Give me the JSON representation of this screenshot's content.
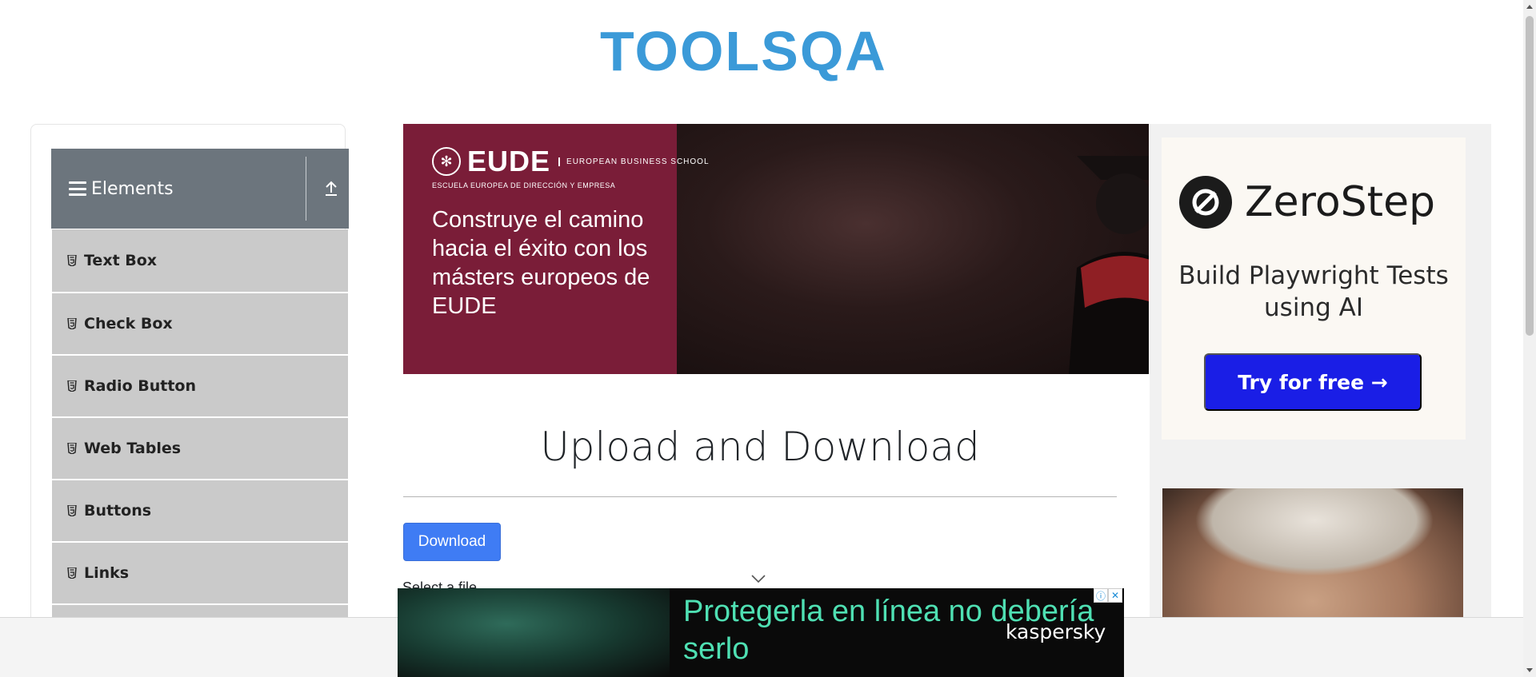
{
  "header": {
    "logo_text": "TOOLSQA"
  },
  "sidebar": {
    "group_title": "Elements",
    "items": [
      {
        "label": "Text Box"
      },
      {
        "label": "Check Box"
      },
      {
        "label": "Radio Button"
      },
      {
        "label": "Web Tables"
      },
      {
        "label": "Buttons"
      },
      {
        "label": "Links"
      }
    ]
  },
  "banner_ad": {
    "brand": "EUDE",
    "brand_sub": "EUROPEAN BUSINESS SCHOOL",
    "tagline": "ESCUELA EUROPEA DE DIRECCIÓN Y EMPRESA",
    "headline": "Construye el camino hacia el éxito con los másters europeos de EUDE"
  },
  "main": {
    "title": "Upload and Download",
    "download_label": "Download",
    "select_label": "Select a file"
  },
  "right_ad": {
    "brand": "ZeroStep",
    "tagline": "Build Playwright Tests using AI",
    "cta": "Try for free →"
  },
  "bottom_ad": {
    "headline": "Protegerla en línea no debería serlo",
    "brand": "kaspersky"
  },
  "colors": {
    "sidebar_header": "#6c757d",
    "menu_item_bg": "#cacaca",
    "primary_button": "#3f7cf4",
    "zerostep_button": "#1a1ee6",
    "kaspersky_green": "#4fe0b3"
  }
}
